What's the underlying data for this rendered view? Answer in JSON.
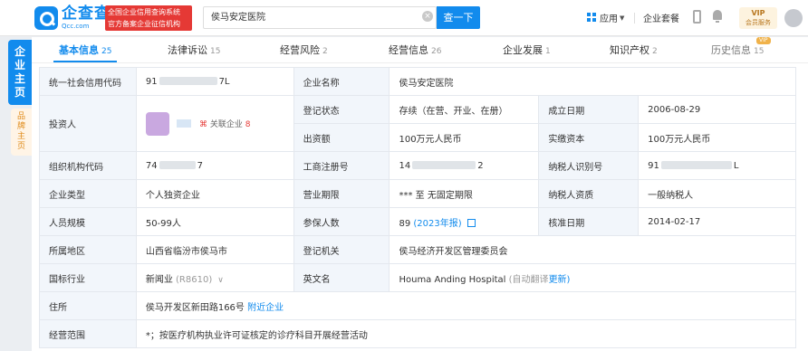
{
  "header": {
    "logo_cn": "企查查",
    "logo_en": "Qcc.com",
    "badge_line1": "全国企业信用查询系统",
    "badge_line2": "官方备案企业征信机构",
    "search_value": "侯马安定医院",
    "search_button": "查一下",
    "app_label": "应用",
    "nav_enterprise": "企业套餐",
    "vip_label": "VIP",
    "vip_sub": "会员服务"
  },
  "side": {
    "main_tab": "企业主页",
    "brand_tab": "品牌主页"
  },
  "tabs": [
    {
      "label": "基本信息",
      "count": "25"
    },
    {
      "label": "法律诉讼",
      "count": "15"
    },
    {
      "label": "经营风险",
      "count": "2"
    },
    {
      "label": "经营信息",
      "count": "26"
    },
    {
      "label": "企业发展",
      "count": "1"
    },
    {
      "label": "知识产权",
      "count": "2"
    },
    {
      "label": "历史信息",
      "count": "15",
      "tag": "VIP"
    }
  ],
  "info": {
    "credit_code_label": "统一社会信用代码",
    "credit_code_prefix": "91",
    "credit_code_suffix": "7L",
    "company_name_label": "企业名称",
    "company_name": "侯马安定医院",
    "investor_label": "投资人",
    "related_label": "关联企业",
    "related_count": "8",
    "reg_status_label": "登记状态",
    "reg_status": "存续（在营、开业、在册）",
    "founded_label": "成立日期",
    "founded": "2006-08-29",
    "capital_label": "出资额",
    "capital": "100万元人民币",
    "paid_capital_label": "实缴资本",
    "paid_capital": "100万元人民币",
    "org_code_label": "组织机构代码",
    "org_code_prefix": "74",
    "org_code_suffix": "7",
    "reg_no_label": "工商注册号",
    "reg_no_prefix": "14",
    "reg_no_suffix": "2",
    "tax_id_label": "纳税人识别号",
    "tax_id_prefix": "91",
    "tax_id_suffix": "L",
    "type_label": "企业类型",
    "type": "个人独资企业",
    "term_label": "营业期限",
    "term": "*** 至 无固定期限",
    "taxpayer_label": "纳税人资质",
    "taxpayer": "一般纳税人",
    "staff_label": "人员规模",
    "staff": "50-99人",
    "insured_label": "参保人数",
    "insured": "89",
    "insured_report": "(2023年报)",
    "approved_label": "核准日期",
    "approved": "2014-02-17",
    "region_label": "所属地区",
    "region": "山西省临汾市侯马市",
    "authority_label": "登记机关",
    "authority": "侯马经济开发区管理委员会",
    "industry_label": "国标行业",
    "industry": "新闻业",
    "industry_code": "(R8610)",
    "english_label": "英文名",
    "english": "Houma Anding Hospital",
    "english_note": "(自动翻译",
    "english_update": "更新)",
    "address_label": "住所",
    "address": "侯马开发区新田路166号",
    "nearby": "附近企业",
    "scope_label": "经营范围",
    "scope": "*；按医疗机构执业许可证核定的诊疗科目开展经营活动"
  }
}
